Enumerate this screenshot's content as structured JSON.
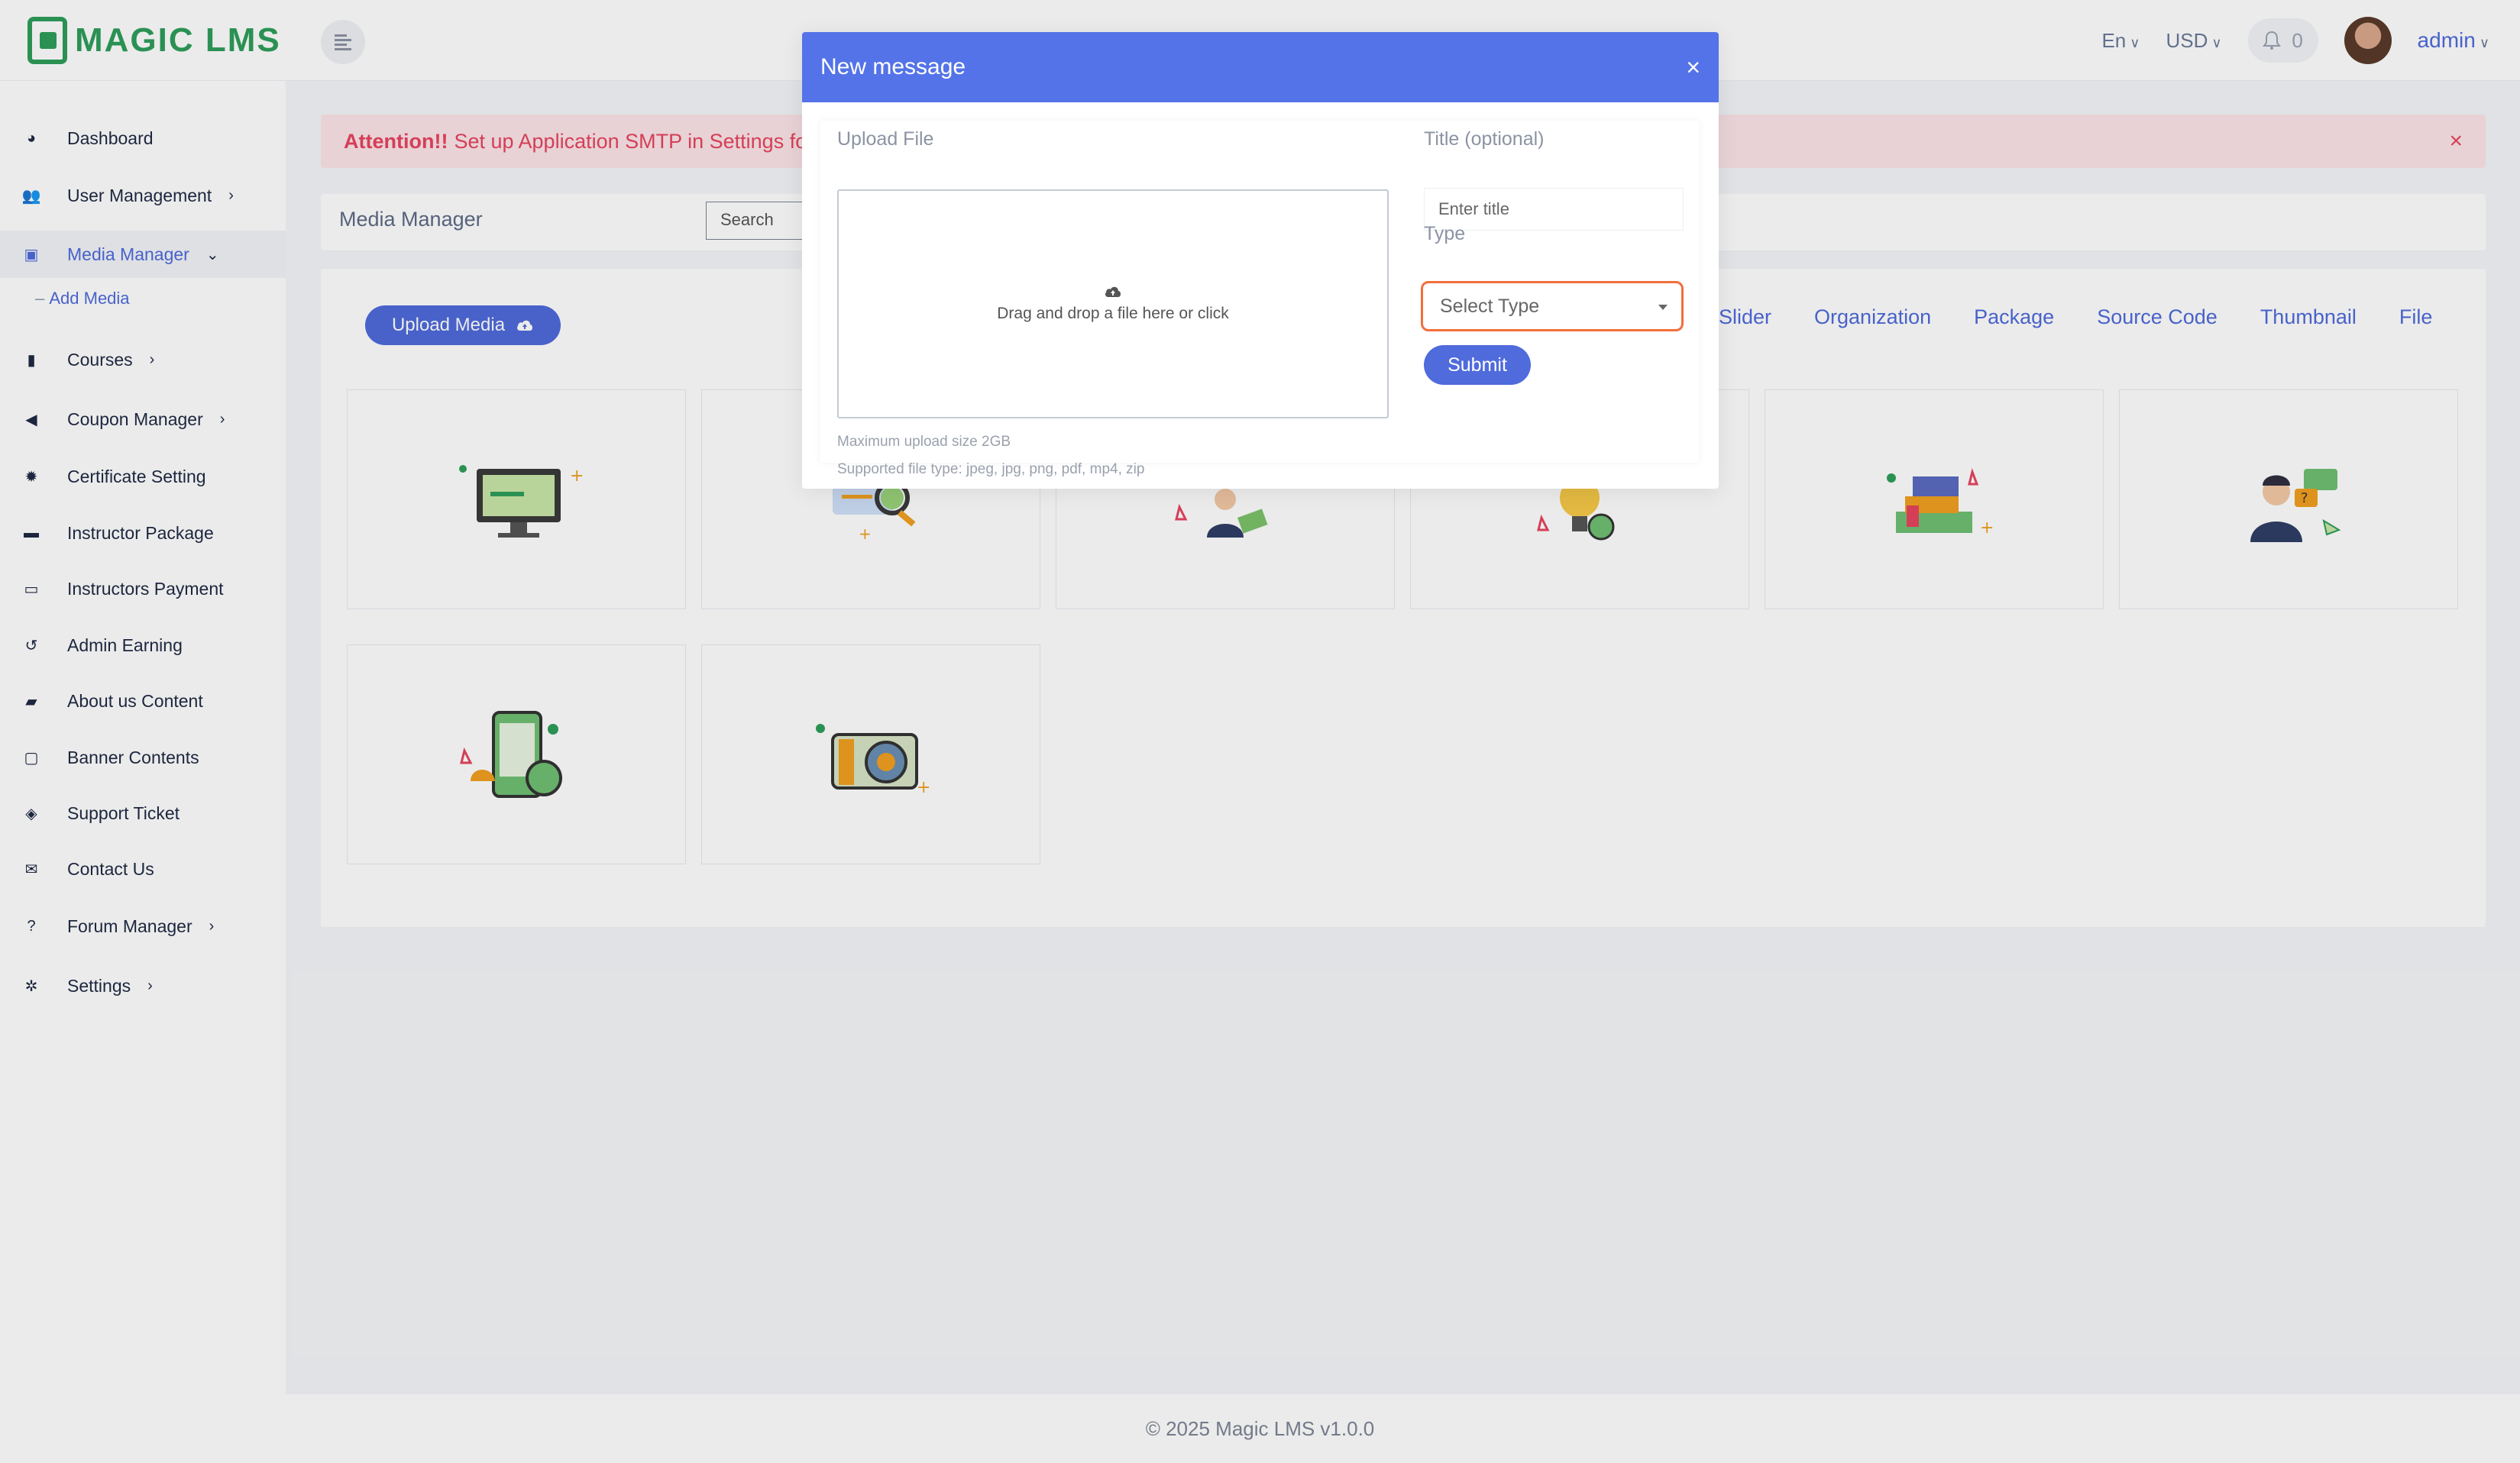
{
  "brand": {
    "name": "MAGIC LMS",
    "accent": "#4f6bdc",
    "green": "#2e9e5b"
  },
  "header": {
    "language": "En",
    "currency": "USD",
    "notification_count": "0",
    "user_name": "admin"
  },
  "sidebar": {
    "items": [
      {
        "label": "Dashboard",
        "icon": "palette-icon"
      },
      {
        "label": "User Management",
        "icon": "users-icon",
        "chevron": "›"
      },
      {
        "label": "Media Manager",
        "icon": "image-icon",
        "chevron": "⌄",
        "active": true
      },
      {
        "label": "Courses",
        "icon": "book-icon",
        "chevron": "›"
      },
      {
        "label": "Coupon Manager",
        "icon": "megaphone-icon",
        "chevron": "›"
      },
      {
        "label": "Certificate Setting",
        "icon": "certificate-icon"
      },
      {
        "label": "Instructor Package",
        "icon": "briefcase-icon"
      },
      {
        "label": "Instructors Payment",
        "icon": "money-icon"
      },
      {
        "label": "Admin Earning",
        "icon": "history-icon"
      },
      {
        "label": "About us Content",
        "icon": "book-open-icon"
      },
      {
        "label": "Banner Contents",
        "icon": "note-icon"
      },
      {
        "label": "Support Ticket",
        "icon": "ticket-icon"
      },
      {
        "label": "Contact Us",
        "icon": "envelope-icon"
      },
      {
        "label": "Forum Manager",
        "icon": "question-icon",
        "chevron": "›"
      },
      {
        "label": "Settings",
        "icon": "gear-icon",
        "chevron": "›"
      }
    ],
    "sub_item": "Add Media"
  },
  "alert": {
    "strong": "Attention!!",
    "text": "Set up Application SMTP in Settings fo",
    "close": "×"
  },
  "media_manager": {
    "title": "Media Manager",
    "search_placeholder": "Search",
    "upload_button": "Upload Media",
    "filters": [
      "Slider",
      "Organization",
      "Package",
      "Source Code",
      "Thumbnail",
      "File"
    ]
  },
  "footer": {
    "text": "© 2025 Magic LMS v1.0.0"
  },
  "modal": {
    "title": "New message",
    "close": "×",
    "upload_label": "Upload File",
    "dropzone_text": "Drag and drop a file here or click",
    "max_size": "Maximum upload size 2GB",
    "supported": "Supported file type: jpeg, jpg, png, pdf, mp4, zip",
    "title_label": "Title (optional)",
    "title_placeholder": "Enter title",
    "type_label": "Type",
    "type_placeholder": "Select Type",
    "submit": "Submit"
  }
}
